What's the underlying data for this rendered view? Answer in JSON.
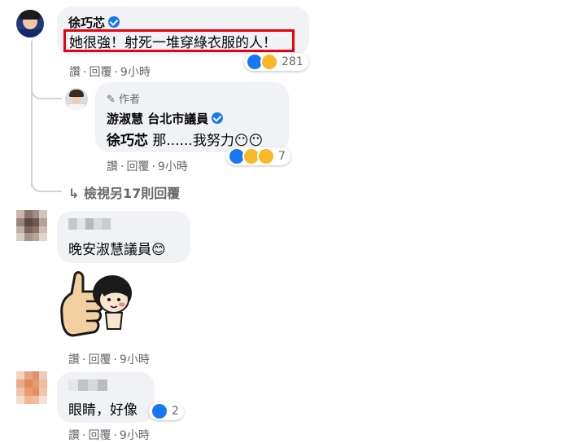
{
  "comments": [
    {
      "author": "徐巧芯",
      "verified": true,
      "text": "她很強！射死一堆穿綠衣服的人！",
      "highlight_color": "#e60012",
      "reactions": {
        "icons": [
          "like-icon",
          "haha-icon"
        ],
        "count": "281"
      },
      "actions": {
        "like": "讚",
        "reply": "回覆",
        "time": "9小時"
      }
    },
    {
      "author_badge": "作者",
      "author": "游淑慧 台北市議員",
      "verified": true,
      "text": "徐巧芯 那......我努力",
      "emoji": "😶😶",
      "reactions": {
        "icons": [
          "like-icon",
          "haha-icon",
          "wow-icon"
        ],
        "count": "7"
      },
      "actions": {
        "like": "讚",
        "reply": "回覆",
        "time": "9小時"
      }
    },
    {
      "more_replies": "檢視另17則回覆"
    },
    {
      "author": "",
      "text": "晚安淑慧議員",
      "emoji": "😊",
      "sticker": "thumbs-up-sticker",
      "actions": {
        "like": "讚",
        "reply": "回覆",
        "time": "9小時"
      }
    },
    {
      "author": "",
      "text": "眼睛，好像",
      "reactions": {
        "icons": [
          "like-icon"
        ],
        "count": "2"
      },
      "actions": {
        "like": "讚",
        "reply": "回覆",
        "time": "9小時"
      }
    }
  ],
  "colors": {
    "like": "#1877f2",
    "haha": "#f7b928",
    "bubble": "#f0f2f5",
    "muted": "#65676b"
  }
}
